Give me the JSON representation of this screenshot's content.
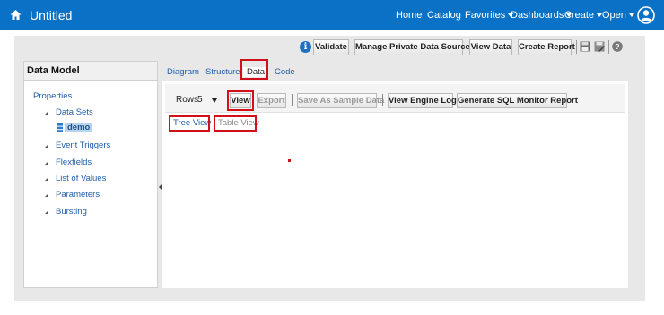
{
  "topbar": {
    "title": "Untitled",
    "home_icon": "home-icon",
    "nav": [
      "Home",
      "Catalog"
    ],
    "menus": [
      "Favorites",
      "Dashboards",
      "Create",
      "Open"
    ],
    "user_icon": "user-avatar-icon",
    "bg_color": "#0a72c6"
  },
  "toolbar": {
    "info_glyph": "i",
    "validate": "Validate",
    "manage_sources": "Manage Private Data Sources",
    "view_data": "View Data",
    "create_report": "Create Report",
    "icons": [
      "save-icon",
      "save-as-icon",
      "help-icon"
    ]
  },
  "left": {
    "header": "Data Model",
    "properties": "Properties",
    "data_sets": "Data Sets",
    "dataset_name": "demo",
    "items": [
      "Event Triggers",
      "Flexfields",
      "List of Values",
      "Parameters",
      "Bursting"
    ]
  },
  "tabs": [
    "Diagram",
    "Structure",
    "Data",
    "Code"
  ],
  "active_tab": "Data",
  "data_toolbar": {
    "rows_label": "Rows",
    "rows_value": "5",
    "view": "View",
    "export": "Export",
    "save_sample": "Save As Sample Data",
    "view_engine_log": "View Engine Log",
    "sql_monitor": "Generate SQL Monitor Report"
  },
  "views": {
    "tree": "Tree View",
    "table": "Table View"
  },
  "colors": {
    "highlight": "#d1101a",
    "link": "#1f5da8"
  }
}
